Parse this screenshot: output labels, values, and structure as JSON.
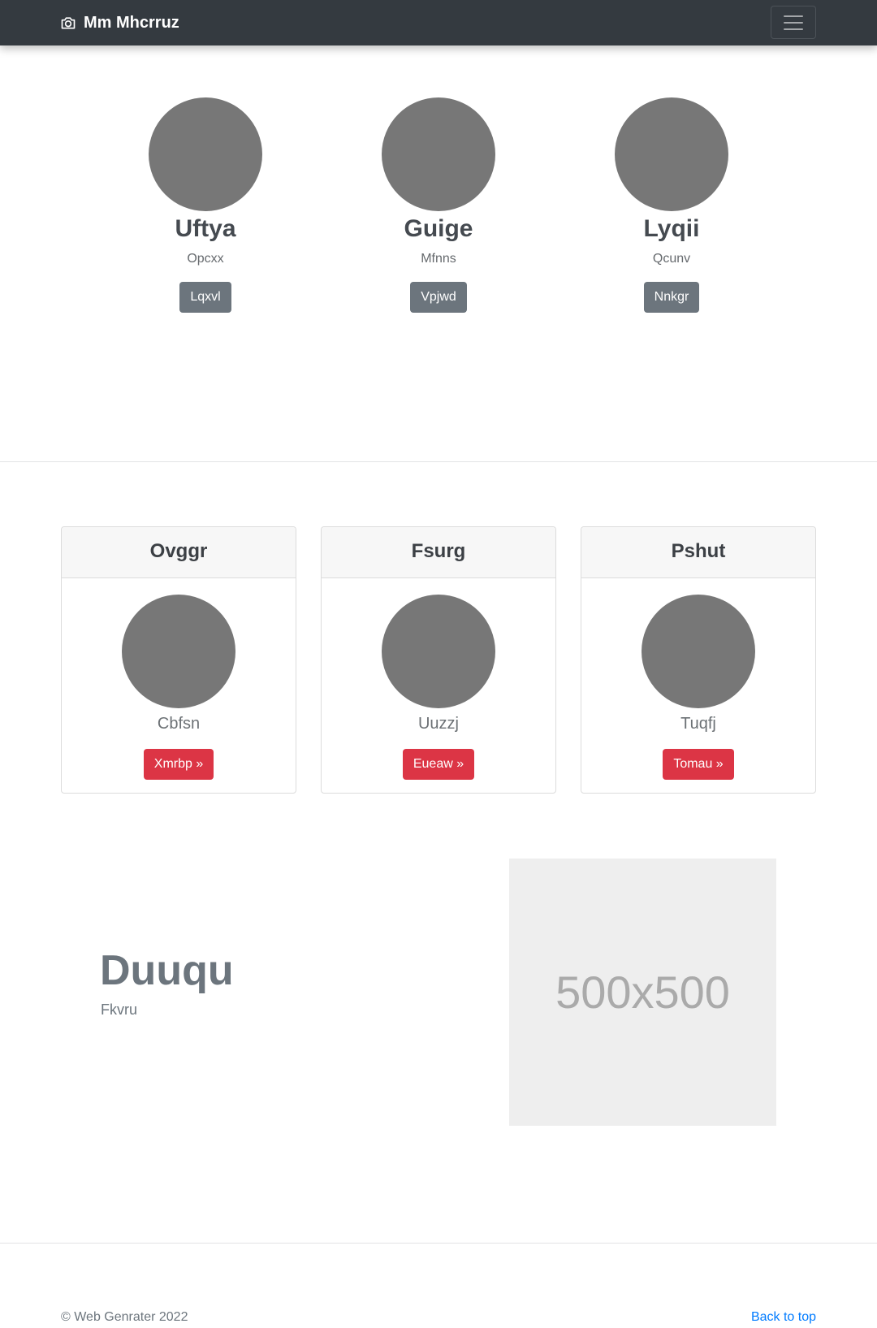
{
  "navbar": {
    "brand": "Mm Mhcrruz",
    "brand_icon": "camera-icon",
    "toggle_icon": "hamburger-icon",
    "background": "#343a40"
  },
  "team": [
    {
      "name": "Uftya",
      "role": "Opcxx",
      "button": "Lqxvl"
    },
    {
      "name": "Guige",
      "role": "Mfnns",
      "button": "Vpjwd"
    },
    {
      "name": "Lyqii",
      "role": "Qcunv",
      "button": "Nnkgr"
    }
  ],
  "cards": [
    {
      "title": "Ovggr",
      "text": "Cbfsn",
      "button": "Xmrbp »"
    },
    {
      "title": "Fsurg",
      "text": "Uuzzj",
      "button": "Eueaw »"
    },
    {
      "title": "Pshut",
      "text": "Tuqfj",
      "button": "Tomau »"
    }
  ],
  "feature": {
    "heading": "Duuqu",
    "subheading": "Fkvru",
    "image_label": "500x500"
  },
  "footer": {
    "copyright": "© Web Genrater 2022",
    "back_to_top": "Back to top"
  },
  "colors": {
    "button_secondary": "#6c757d",
    "button_danger": "#dc3545",
    "link": "#007bff",
    "avatar": "#777777"
  }
}
